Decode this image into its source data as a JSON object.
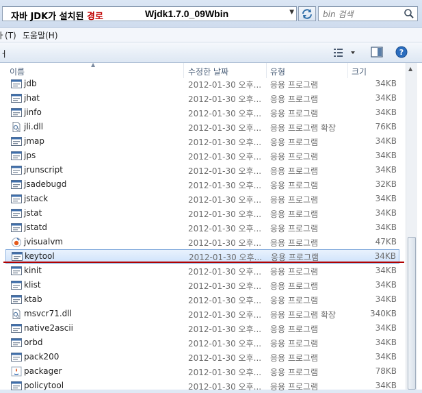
{
  "address": {
    "annotation_prefix": "자바 JDK가 설치된 ",
    "annotation_highlight": "경로",
    "path": "Wjdk1.7.0_09Wbin"
  },
  "search": {
    "placeholder": "bin 검색"
  },
  "menu": {
    "partial_left": "ㅏ(T)",
    "help": "도움말(H)"
  },
  "toolbar": {
    "partial_left": "ㅓ"
  },
  "columns": {
    "name": "이름",
    "date": "수정한 날짜",
    "type": "유형",
    "size": "크기"
  },
  "files": [
    {
      "name": "jdb",
      "date": "2012-01-30 오후...",
      "type": "응용 프로그램",
      "size": "34KB",
      "icon": "exe-icon"
    },
    {
      "name": "jhat",
      "date": "2012-01-30 오후...",
      "type": "응용 프로그램",
      "size": "34KB",
      "icon": "exe-icon"
    },
    {
      "name": "jinfo",
      "date": "2012-01-30 오후...",
      "type": "응용 프로그램",
      "size": "34KB",
      "icon": "exe-icon"
    },
    {
      "name": "jli.dll",
      "date": "2012-01-30 오후...",
      "type": "응용 프로그램 확장",
      "size": "76KB",
      "icon": "dll-icon"
    },
    {
      "name": "jmap",
      "date": "2012-01-30 오후...",
      "type": "응용 프로그램",
      "size": "34KB",
      "icon": "exe-icon"
    },
    {
      "name": "jps",
      "date": "2012-01-30 오후...",
      "type": "응용 프로그램",
      "size": "34KB",
      "icon": "exe-icon"
    },
    {
      "name": "jrunscript",
      "date": "2012-01-30 오후...",
      "type": "응용 프로그램",
      "size": "34KB",
      "icon": "exe-icon"
    },
    {
      "name": "jsadebugd",
      "date": "2012-01-30 오후...",
      "type": "응용 프로그램",
      "size": "32KB",
      "icon": "exe-icon"
    },
    {
      "name": "jstack",
      "date": "2012-01-30 오후...",
      "type": "응용 프로그램",
      "size": "34KB",
      "icon": "exe-icon"
    },
    {
      "name": "jstat",
      "date": "2012-01-30 오후...",
      "type": "응용 프로그램",
      "size": "34KB",
      "icon": "exe-icon"
    },
    {
      "name": "jstatd",
      "date": "2012-01-30 오후...",
      "type": "응용 프로그램",
      "size": "34KB",
      "icon": "exe-icon"
    },
    {
      "name": "jvisualvm",
      "date": "2012-01-30 오후...",
      "type": "응용 프로그램",
      "size": "47KB",
      "icon": "jvisualvm-icon"
    },
    {
      "name": "keytool",
      "date": "2012-01-30 오후...",
      "type": "응용 프로그램",
      "size": "34KB",
      "icon": "exe-icon",
      "selected": true
    },
    {
      "name": "kinit",
      "date": "2012-01-30 오후...",
      "type": "응용 프로그램",
      "size": "34KB",
      "icon": "exe-icon"
    },
    {
      "name": "klist",
      "date": "2012-01-30 오후...",
      "type": "응용 프로그램",
      "size": "34KB",
      "icon": "exe-icon"
    },
    {
      "name": "ktab",
      "date": "2012-01-30 오후...",
      "type": "응용 프로그램",
      "size": "34KB",
      "icon": "exe-icon"
    },
    {
      "name": "msvcr71.dll",
      "date": "2012-01-30 오후...",
      "type": "응용 프로그램 확장",
      "size": "340KB",
      "icon": "dll-icon"
    },
    {
      "name": "native2ascii",
      "date": "2012-01-30 오후...",
      "type": "응용 프로그램",
      "size": "34KB",
      "icon": "exe-icon"
    },
    {
      "name": "orbd",
      "date": "2012-01-30 오후...",
      "type": "응용 프로그램",
      "size": "34KB",
      "icon": "exe-icon"
    },
    {
      "name": "pack200",
      "date": "2012-01-30 오후...",
      "type": "응용 프로그램",
      "size": "34KB",
      "icon": "exe-icon"
    },
    {
      "name": "packager",
      "date": "2012-01-30 오후...",
      "type": "응용 프로그램",
      "size": "78KB",
      "icon": "java-icon"
    },
    {
      "name": "policytool",
      "date": "2012-01-30 오후...",
      "type": "응용 프로그램",
      "size": "34KB",
      "icon": "exe-icon"
    }
  ]
}
